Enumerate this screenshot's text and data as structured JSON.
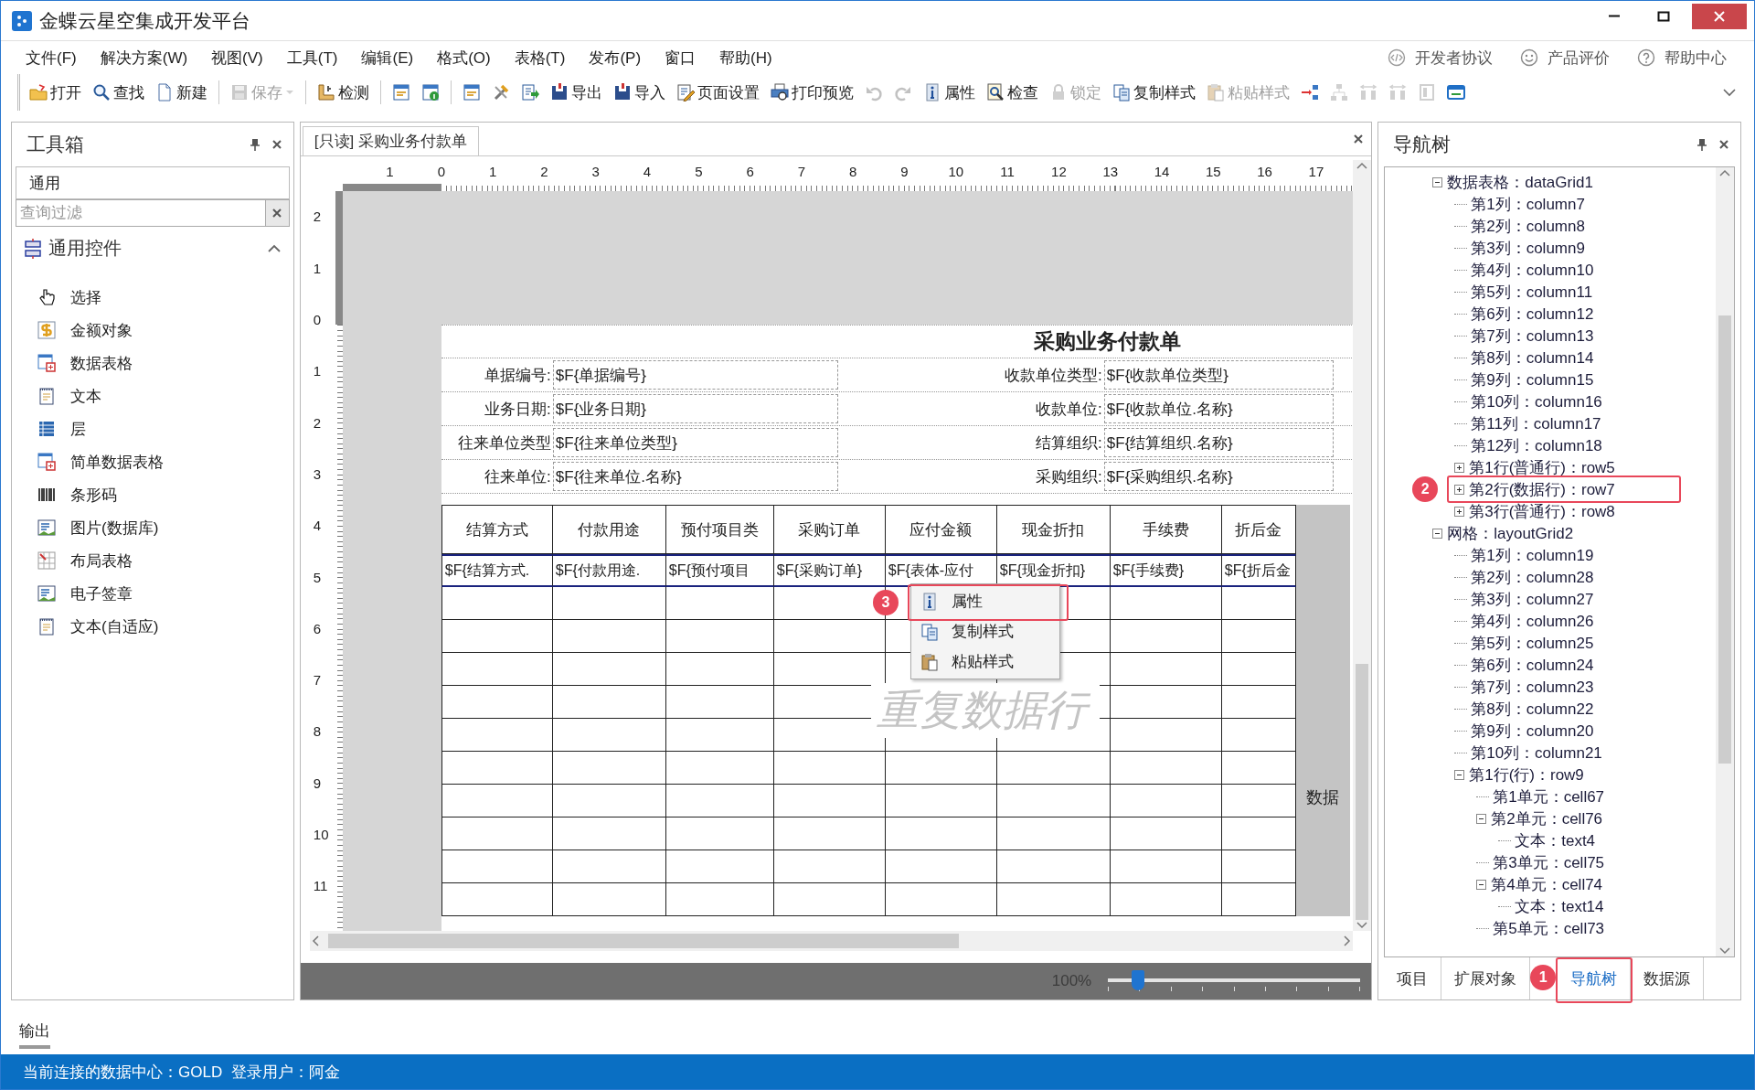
{
  "window": {
    "title": "金蝶云星空集成开发平台"
  },
  "menu": [
    "文件(F)",
    "解决方案(W)",
    "视图(V)",
    "工具(T)",
    "编辑(E)",
    "格式(O)",
    "表格(T)",
    "发布(P)",
    "窗口",
    "帮助(H)"
  ],
  "header_links": [
    "开发者协议",
    "产品评价",
    "帮助中心"
  ],
  "toolbar": [
    {
      "kind": "button",
      "label": "打开",
      "disabled": false
    },
    {
      "kind": "button",
      "label": "查找",
      "disabled": false
    },
    {
      "kind": "button",
      "label": "新建",
      "disabled": false
    },
    {
      "kind": "separator"
    },
    {
      "kind": "split",
      "label": "保存",
      "disabled": true
    },
    {
      "kind": "separator"
    },
    {
      "kind": "button",
      "label": "检测",
      "disabled": false
    },
    {
      "kind": "separator"
    },
    {
      "kind": "icon",
      "disabled": false
    },
    {
      "kind": "icon",
      "disabled": false
    },
    {
      "kind": "separator"
    },
    {
      "kind": "icon",
      "disabled": false
    },
    {
      "kind": "icon",
      "disabled": false
    },
    {
      "kind": "icon",
      "disabled": false
    },
    {
      "kind": "button",
      "label": "导出",
      "disabled": false
    },
    {
      "kind": "button",
      "label": "导入",
      "disabled": false
    },
    {
      "kind": "button",
      "label": "页面设置",
      "disabled": false
    },
    {
      "kind": "button",
      "label": "打印预览",
      "disabled": false
    },
    {
      "kind": "icon",
      "disabled": true
    },
    {
      "kind": "icon",
      "disabled": true
    },
    {
      "kind": "button",
      "label": "属性",
      "disabled": false
    },
    {
      "kind": "button",
      "label": "检查",
      "disabled": false
    },
    {
      "kind": "button",
      "label": "锁定",
      "disabled": true
    },
    {
      "kind": "button",
      "label": "复制样式",
      "disabled": false
    },
    {
      "kind": "button",
      "label": "粘贴样式",
      "disabled": true
    },
    {
      "kind": "icon",
      "disabled": false
    },
    {
      "kind": "icon",
      "disabled": true
    },
    {
      "kind": "icon",
      "disabled": true
    },
    {
      "kind": "icon",
      "disabled": true
    },
    {
      "kind": "icon",
      "disabled": true
    },
    {
      "kind": "icon",
      "disabled": false
    },
    {
      "kind": "overflow"
    }
  ],
  "toolbox": {
    "title": "工具箱",
    "group": "通用",
    "filter_placeholder": "查询过滤",
    "section": {
      "title": "通用控件",
      "expanded": true
    },
    "items": [
      "选择",
      "金额对象",
      "数据表格",
      "文本",
      "层",
      "简单数据表格",
      "条形码",
      "图片(数据库)",
      "布局表格",
      "电子签章",
      "文本(自适应)"
    ]
  },
  "document": {
    "tab": "[只读] 采购业务付款单",
    "ruler_h": [
      "1",
      "0",
      "1",
      "2",
      "3",
      "4",
      "5",
      "6",
      "7",
      "8",
      "9",
      "10",
      "11",
      "12",
      "13",
      "14",
      "15",
      "16",
      "17"
    ],
    "ruler_v": [
      "2",
      "1",
      "0",
      "1",
      "2",
      "3",
      "4",
      "5",
      "6",
      "7",
      "8",
      "9",
      "10",
      "11"
    ],
    "form_title": "采购业务付款单",
    "form_rows": [
      {
        "left_label": "单据编号:",
        "left_value": "$F{单据编号}",
        "right_label": "收款单位类型:",
        "right_value": "$F{收款单位类型}"
      },
      {
        "left_label": "业务日期:",
        "left_value": "$F{业务日期}",
        "right_label": "收款单位:",
        "right_value": "$F{收款单位.名称}"
      },
      {
        "left_label": "往来单位类型",
        "left_value": "$F{往来单位类型}",
        "right_label": "结算组织:",
        "right_value": "$F{结算组织.名称}"
      },
      {
        "left_label": "往来单位:",
        "left_value": "$F{往来单位.名称}",
        "right_label": "采购组织:",
        "right_value": "$F{采购组织.名称}"
      }
    ],
    "grid_columns": [
      "结算方式",
      "付款用途",
      "预付项目类",
      "采购订单",
      "应付金额",
      "现金折扣",
      "手续费",
      "折后金"
    ],
    "grid_data_row": [
      "$F{结算方式.",
      "$F{付款用途.",
      "$F{预付项目",
      "$F{采购订单}",
      "$F{表体-应付",
      "$F{现金折扣}",
      "$F{手续费}",
      "$F{折后金"
    ],
    "side_label": "数据",
    "watermark": "重复数据行",
    "context_menu": [
      {
        "label": "属性",
        "callout": "3"
      },
      {
        "label": "复制样式"
      },
      {
        "label": "粘贴样式"
      }
    ],
    "zoom": {
      "reading": "100%",
      "level": 0.12
    }
  },
  "navigator": {
    "title": "导航树",
    "tree": [
      {
        "label": "数据表格：dataGrid1",
        "expanded": true,
        "children": [
          {
            "label": "第1列：column7"
          },
          {
            "label": "第2列：column8"
          },
          {
            "label": "第3列：column9"
          },
          {
            "label": "第4列：column10"
          },
          {
            "label": "第5列：column11"
          },
          {
            "label": "第6列：column12"
          },
          {
            "label": "第7列：column13"
          },
          {
            "label": "第8列：column14"
          },
          {
            "label": "第9列：column15"
          },
          {
            "label": "第10列：column16"
          },
          {
            "label": "第11列：column17"
          },
          {
            "label": "第12列：column18"
          },
          {
            "label": "第1行(普通行)：row5",
            "expanded": false
          },
          {
            "label": "第2行(数据行)：row7",
            "expanded": false,
            "callout": "2"
          },
          {
            "label": "第3行(普通行)：row8",
            "expanded": false
          }
        ]
      },
      {
        "label": "网格：layoutGrid2",
        "expanded": true,
        "children": [
          {
            "label": "第1列：column19"
          },
          {
            "label": "第2列：column28"
          },
          {
            "label": "第3列：column27"
          },
          {
            "label": "第4列：column26"
          },
          {
            "label": "第5列：column25"
          },
          {
            "label": "第6列：column24"
          },
          {
            "label": "第7列：column23"
          },
          {
            "label": "第8列：column22"
          },
          {
            "label": "第9列：column20"
          },
          {
            "label": "第10列：column21"
          },
          {
            "label": "第1行(行)：row9",
            "expanded": true,
            "children": [
              {
                "label": "第1单元：cell67"
              },
              {
                "label": "第2单元：cell76",
                "expanded": true,
                "children": [
                  {
                    "label": "文本：text4"
                  }
                ]
              },
              {
                "label": "第3单元：cell75"
              },
              {
                "label": "第4单元：cell74",
                "expanded": true,
                "children": [
                  {
                    "label": "文本：text14"
                  }
                ]
              },
              {
                "label": "第5单元：cell73"
              }
            ]
          }
        ]
      }
    ],
    "tabs": [
      {
        "label": "项目",
        "selected": false
      },
      {
        "label": "扩展对象",
        "selected": false
      },
      {
        "label": "导航树",
        "selected": true,
        "callout": "1"
      },
      {
        "label": "数据源",
        "selected": false
      }
    ]
  },
  "output_tab": "输出",
  "status_bar": "当前连接的数据中心：GOLD  登录用户：阿金"
}
